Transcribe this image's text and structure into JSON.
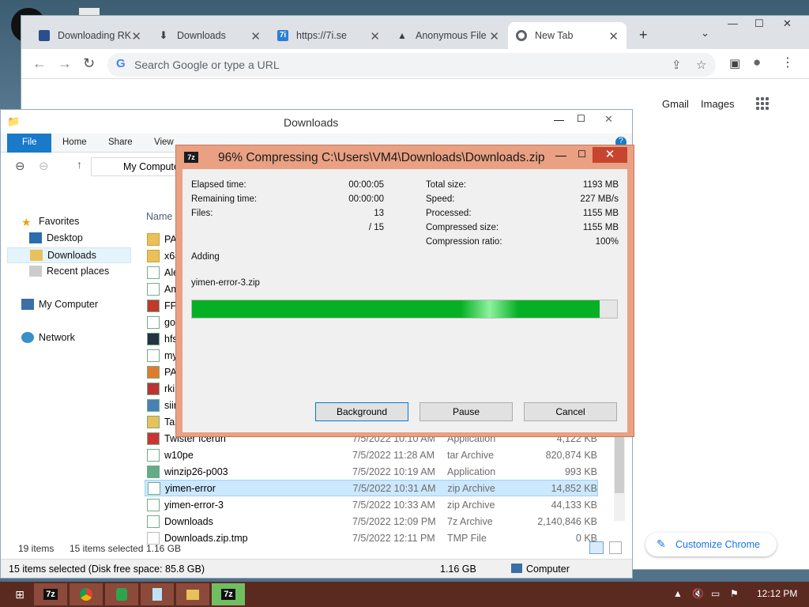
{
  "chrome": {
    "tabs": [
      {
        "label": "Downloading RK",
        "favicon": "7i-favicon"
      },
      {
        "label": "Downloads",
        "favicon": "download-icon"
      },
      {
        "label": "https://7i.se",
        "favicon": "7i-favicon"
      },
      {
        "label": "Anonymous File",
        "favicon": "anonfiles-favicon"
      },
      {
        "label": "New Tab",
        "favicon": "chrome-icon"
      }
    ],
    "omnibox_placeholder": "Search Google or type a URL",
    "gmail": "Gmail",
    "images": "Images",
    "customize": "Customize Chrome"
  },
  "explorer": {
    "title": "Downloads",
    "ribbon_tabs": [
      "File",
      "Home",
      "Share",
      "View"
    ],
    "address": "My Computer",
    "nav": {
      "favorites": "Favorites",
      "desktop": "Desktop",
      "downloads": "Downloads",
      "recent": "Recent places",
      "computer": "My Computer",
      "network": "Network"
    },
    "column_name": "Name",
    "partial_names": [
      "PA",
      "x64",
      "Ale",
      "Am",
      "FFA",
      "goo",
      "hfs",
      "my",
      "PA",
      "rkil",
      "siir",
      "Tas"
    ],
    "files": [
      {
        "name": "Twister Iceruh",
        "date": "7/5/2022 10:10 AM",
        "type": "Application",
        "size": "4,122 KB"
      },
      {
        "name": "w10pe",
        "date": "7/5/2022 11:28 AM",
        "type": "tar Archive",
        "size": "820,874 KB"
      },
      {
        "name": "winzip26-p003",
        "date": "7/5/2022 10:19 AM",
        "type": "Application",
        "size": "993 KB"
      },
      {
        "name": "yimen-error",
        "date": "7/5/2022 10:31 AM",
        "type": "zip Archive",
        "size": "14,852 KB"
      },
      {
        "name": "yimen-error-3",
        "date": "7/5/2022 10:33 AM",
        "type": "zip Archive",
        "size": "44,133 KB"
      },
      {
        "name": "Downloads",
        "date": "7/5/2022 12:09 PM",
        "type": "7z Archive",
        "size": "2,140,846 KB"
      },
      {
        "name": "Downloads.zip.tmp",
        "date": "7/5/2022 12:11 PM",
        "type": "TMP File",
        "size": "0 KB"
      }
    ],
    "status_items": "19 items",
    "status_selected": "15 items selected",
    "status_size": "1.16 GB",
    "detail_left": "15 items selected (Disk free space: 85.8 GB)",
    "detail_size": "1.16 GB",
    "detail_location": "Computer"
  },
  "zip": {
    "title": "96% Compressing C:\\Users\\VM4\\Downloads\\Downloads.zip",
    "icon_label": "7z",
    "elapsed_label": "Elapsed time:",
    "elapsed": "00:00:05",
    "remaining_label": "Remaining time:",
    "remaining": "00:00:00",
    "files_label": "Files:",
    "files": "13",
    "files_total": "/ 15",
    "total_size_label": "Total size:",
    "total_size": "1193 MB",
    "speed_label": "Speed:",
    "speed": "227 MB/s",
    "processed_label": "Processed:",
    "processed": "1155 MB",
    "compressed_label": "Compressed size:",
    "compressed": "1155 MB",
    "ratio_label": "Compression ratio:",
    "ratio": "100%",
    "action": "Adding",
    "current_file": "yimen-error-3.zip",
    "progress": 0.96,
    "background": "Background",
    "pause": "Pause",
    "cancel": "Cancel"
  },
  "taskbar": {
    "time": "12:12 PM",
    "apps": [
      "7z",
      "chrome",
      "shield",
      "notepad",
      "explorer",
      "7z"
    ]
  }
}
